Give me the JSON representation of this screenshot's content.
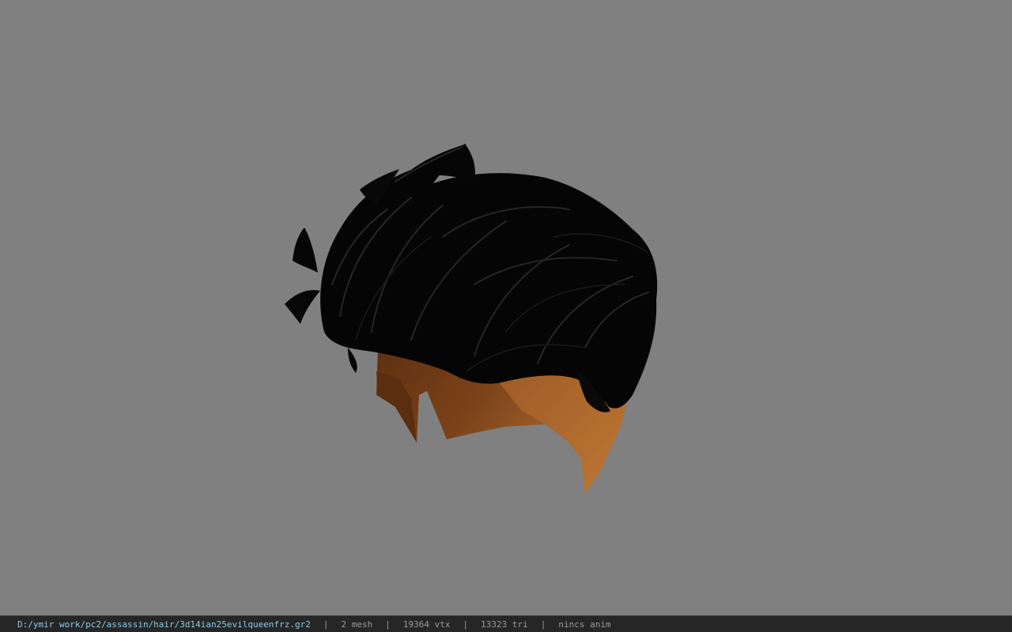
{
  "viewport": {
    "background_color": "#808080",
    "model_description": "hair-mesh",
    "colors": {
      "hair": "#050505",
      "hair_highlight": "#2a2a2a",
      "skin_dark": "#6e3a14",
      "skin_mid": "#8a4c1e",
      "skin_light": "#b06a30"
    }
  },
  "status_bar": {
    "file_path": "D:/ymir work/pc2/assassin/hair/3d14ian25evilqueenfrz.gr2",
    "separator": "|",
    "mesh_count": "2 mesh",
    "vertex_count": "19364 vtx",
    "triangle_count": "13323 tri",
    "animation": "nincs anim",
    "background_color": "#262626",
    "path_color": "#8ec8e8"
  }
}
